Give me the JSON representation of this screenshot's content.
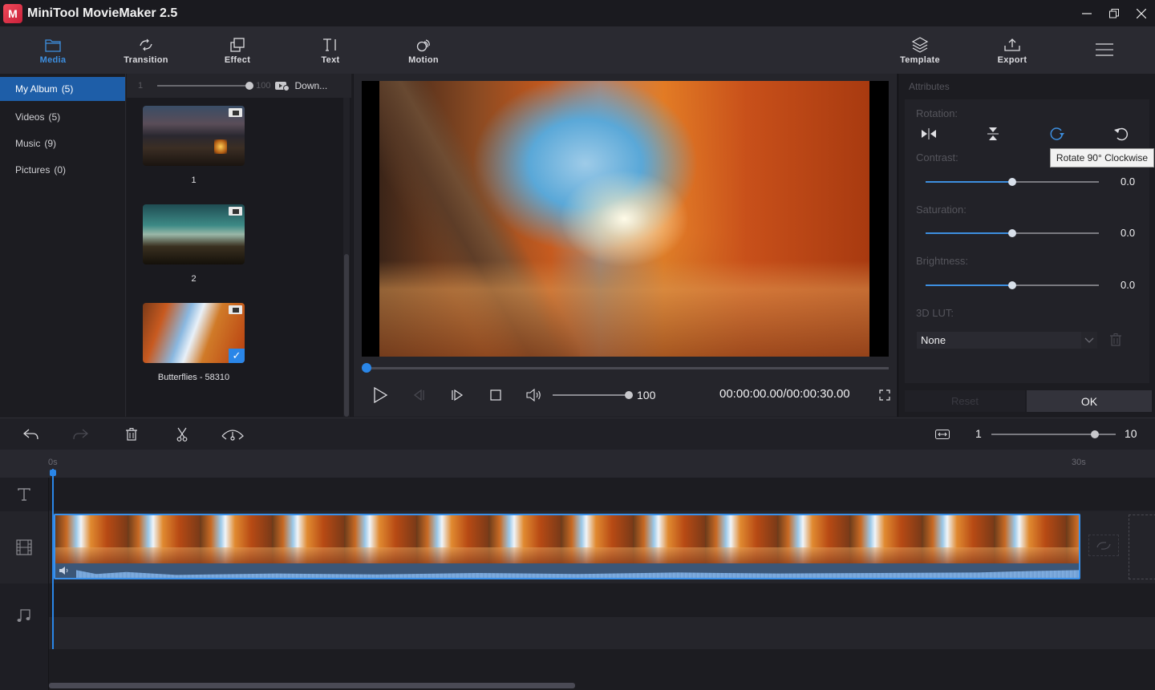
{
  "app": {
    "title": "MiniTool MovieMaker 2.5",
    "logo_letter": "M",
    "window_controls": [
      "minimize",
      "restore",
      "close"
    ]
  },
  "toolbar": {
    "tabs": [
      {
        "label": "Media",
        "icon": "folder-icon",
        "active": true
      },
      {
        "label": "Transition",
        "icon": "transition-icon",
        "active": false
      },
      {
        "label": "Effect",
        "icon": "effect-icon",
        "active": false
      },
      {
        "label": "Text",
        "icon": "text-icon",
        "active": false
      },
      {
        "label": "Motion",
        "icon": "motion-icon",
        "active": false
      }
    ],
    "right": [
      {
        "label": "Template",
        "icon": "layers-icon"
      },
      {
        "label": "Export",
        "icon": "upload-icon"
      }
    ],
    "menu_icon": "hamburger-menu-icon"
  },
  "library": {
    "items": [
      {
        "label": "My Album",
        "count": "(5)",
        "active": true
      },
      {
        "label": "Videos",
        "count": "(5)",
        "active": false
      },
      {
        "label": "Music",
        "count": "(9)",
        "active": false
      },
      {
        "label": "Pictures",
        "count": "(0)",
        "active": false
      }
    ]
  },
  "media": {
    "size_min": "1",
    "size_max": "100",
    "size_value_fraction": 1.0,
    "download_label": "Down...",
    "clips": [
      {
        "label": "1",
        "type": "video",
        "selected": false
      },
      {
        "label": "2",
        "type": "video",
        "selected": false
      },
      {
        "label": "Butterflies - 58310",
        "type": "video",
        "selected": true
      }
    ]
  },
  "player": {
    "seek_fraction": 0.0,
    "volume": "100",
    "volume_fraction": 1.0,
    "timecode": "00:00:00.00/00:00:30.00"
  },
  "attributes": {
    "title": "Attributes",
    "rotation_label": "Rotation:",
    "rotation_buttons": [
      "flip-horizontal",
      "flip-vertical",
      "rotate-90-clockwise",
      "rotate-90-counterclockwise"
    ],
    "tooltip": "Rotate 90° Clockwise",
    "contrast": {
      "label": "Contrast:",
      "value": "0.0",
      "fraction": 0.5
    },
    "saturation": {
      "label": "Saturation:",
      "value": "0.0",
      "fraction": 0.5
    },
    "brightness": {
      "label": "Brightness:",
      "value": "0.0",
      "fraction": 0.5
    },
    "lut_label": "3D LUT:",
    "lut_value": "None",
    "reset_label": "Reset",
    "ok_label": "OK"
  },
  "timeline": {
    "zoom_min": "1",
    "zoom_max": "10",
    "zoom_fraction": 0.83,
    "ruler": [
      "0s",
      "30s"
    ],
    "tracks": [
      "text-track",
      "video-track",
      "music-track"
    ]
  },
  "colors": {
    "accent": "#2a86e8",
    "active_tab": "#3d8fe0",
    "selected_nav": "#1e5ea8",
    "background": "#1c1c21"
  }
}
